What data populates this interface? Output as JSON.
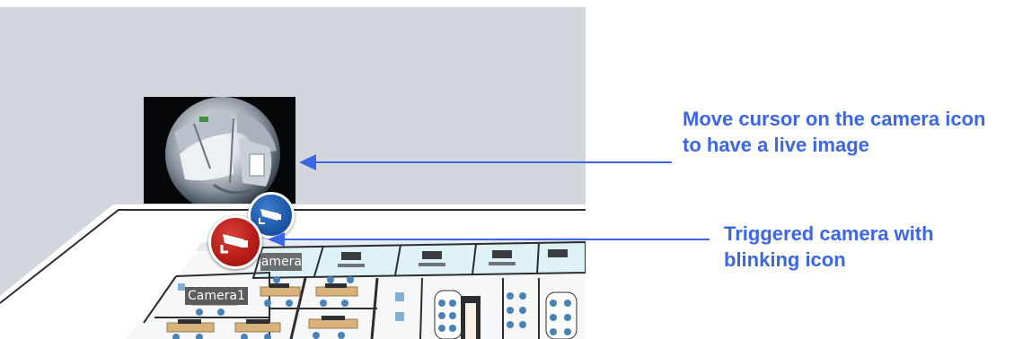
{
  "map": {
    "camera_icons": [
      {
        "id": "camera1",
        "state": "triggered",
        "icon": "camera-icon",
        "color": "#c0221c",
        "label": "Camera1"
      },
      {
        "id": "camera2",
        "state": "normal",
        "icon": "camera-icon",
        "color": "#1f5bb0",
        "label": "Camera2"
      }
    ],
    "preview": {
      "icon": "fisheye-live-image"
    }
  },
  "annotations": {
    "hover_tip": "Move cursor on the camera icon to have a live image",
    "trigger_tip": "Triggered camera with blinking icon",
    "color": "#3b66e6"
  }
}
